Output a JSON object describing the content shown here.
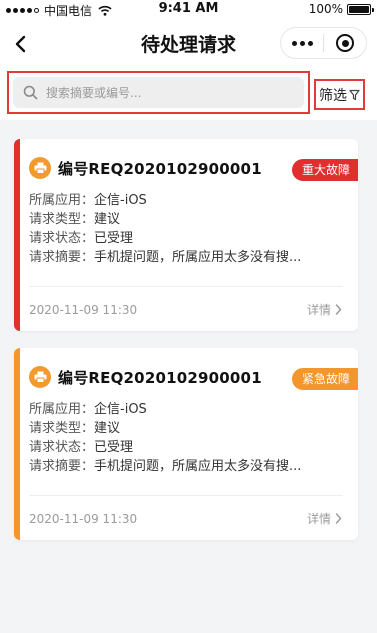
{
  "status_bar": {
    "carrier": "中国电信",
    "time": "9:41 AM",
    "battery": "100%"
  },
  "nav": {
    "title": "待处理请求"
  },
  "search": {
    "placeholder": "搜索摘要或编号...",
    "value": ""
  },
  "filter": {
    "label": "筛选"
  },
  "labels": {
    "app": "所属应用：",
    "type": "请求类型：",
    "status": "请求状态：",
    "summary": "请求摘要：",
    "detail": "详情"
  },
  "requests": [
    {
      "number": "编号REQ2020102900001",
      "badge": "重大故障",
      "badge_color": "#e02f2f",
      "stripe_color": "#e02f2f",
      "app": "企信-iOS",
      "type": "建议",
      "status": "已受理",
      "summary": "手机提问题，所属应用太多没有搜...",
      "date": "2020-11-09  11:30"
    },
    {
      "number": "编号REQ2020102900001",
      "badge": "紧急故障",
      "badge_color": "#f4962b",
      "stripe_color": "#f4962b",
      "app": "企信-iOS",
      "type": "建议",
      "status": "已受理",
      "summary": "手机提问题，所属应用太多没有搜...",
      "date": "2020-11-09  11:30"
    }
  ],
  "icons": {
    "back": "chevron-left-icon",
    "more": "more-dots-icon",
    "target": "target-icon",
    "search": "search-icon",
    "filter": "filter-funnel-icon",
    "request_type": "printer-icon",
    "detail": "chevron-right-icon"
  }
}
